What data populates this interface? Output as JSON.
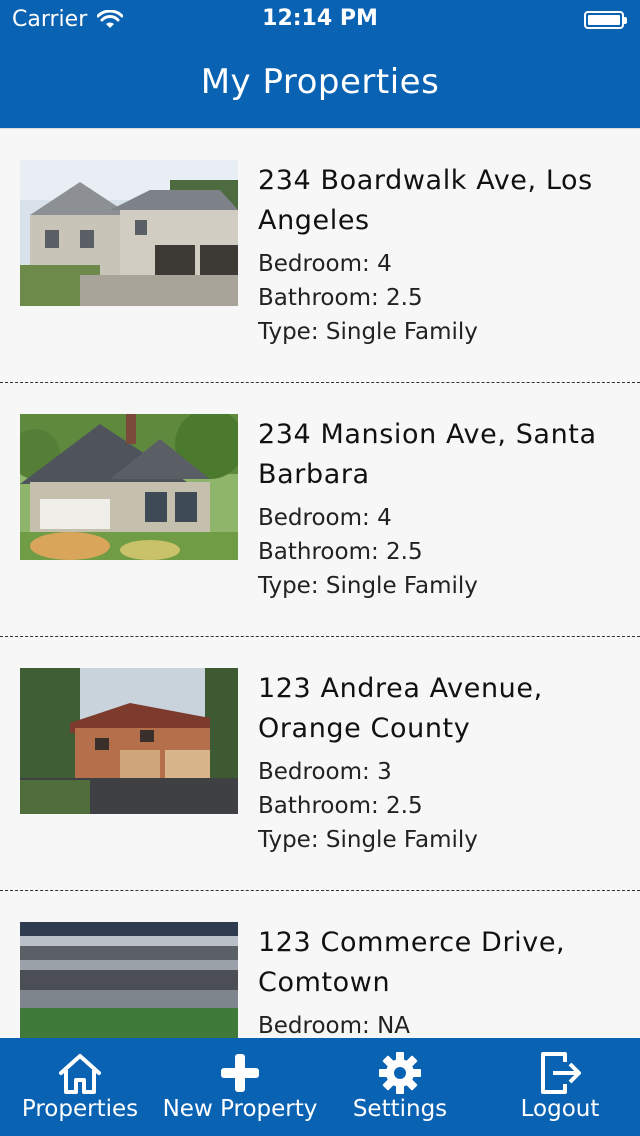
{
  "status_bar": {
    "carrier": "Carrier",
    "time": "12:14 PM"
  },
  "header": {
    "title": "My Properties"
  },
  "properties": [
    {
      "address": "234 Boardwalk Ave, Los Angeles",
      "bedroom": "Bedroom: 4",
      "bathroom": "Bathroom: 2.5",
      "type": "Type: Single Family",
      "image": "house-photo"
    },
    {
      "address": "234 Mansion Ave, Santa Barbara",
      "bedroom": "Bedroom: 4",
      "bathroom": "Bathroom: 2.5",
      "type": "Type: Single Family",
      "image": "house-photo"
    },
    {
      "address": "123 Andrea Avenue, Orange County",
      "bedroom": "Bedroom: 3",
      "bathroom": "Bathroom: 2.5",
      "type": "Type: Single Family",
      "image": "house-photo"
    },
    {
      "address": "123 Commerce Drive, Comtown",
      "bedroom": "Bedroom: NA",
      "bathroom": "",
      "type": "",
      "image": "stadium-photo"
    }
  ],
  "tabs": [
    {
      "label": "Properties",
      "icon": "home-icon"
    },
    {
      "label": "New Property",
      "icon": "plus-icon"
    },
    {
      "label": "Settings",
      "icon": "gear-icon"
    },
    {
      "label": "Logout",
      "icon": "logout-icon"
    }
  ],
  "colors": {
    "brand": "#0a62b3",
    "background": "#f7f7f7"
  }
}
